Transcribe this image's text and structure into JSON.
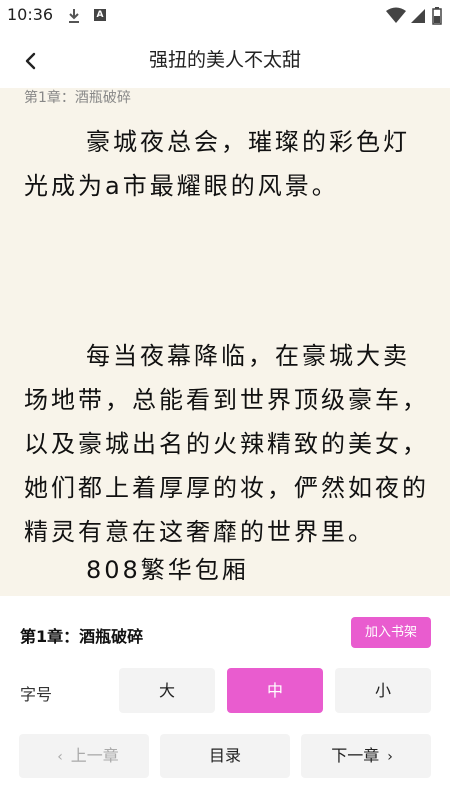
{
  "status_bar": {
    "time": "10:36"
  },
  "header": {
    "title": "强扭的美人不太甜"
  },
  "reader": {
    "chapter_label": "第1章：酒瓶破碎",
    "paragraphs": [
      "豪城夜总会，璀璨的彩色灯光成为a市最耀眼的风景。",
      "每当夜幕降临，在豪城大卖场地带，总能看到世界顶级豪车，以及豪城出名的火辣精致的美女，她们都上着厚厚的妆，俨然如夜的精灵有意在这奢靡的世界里。",
      "808繁华包厢"
    ]
  },
  "panel": {
    "chapter_name": "第1章：酒瓶破碎",
    "add_shelf_label": "加入书架",
    "font_size_label": "字号",
    "font_sizes": [
      "大",
      "中",
      "小"
    ],
    "selected_font_size": "中",
    "prev_label": "上一章",
    "toc_label": "目录",
    "next_label": "下一章"
  },
  "colors": {
    "accent": "#e95ccf",
    "paper": "#f8f4ea",
    "button_bg": "#f3f3f3"
  }
}
